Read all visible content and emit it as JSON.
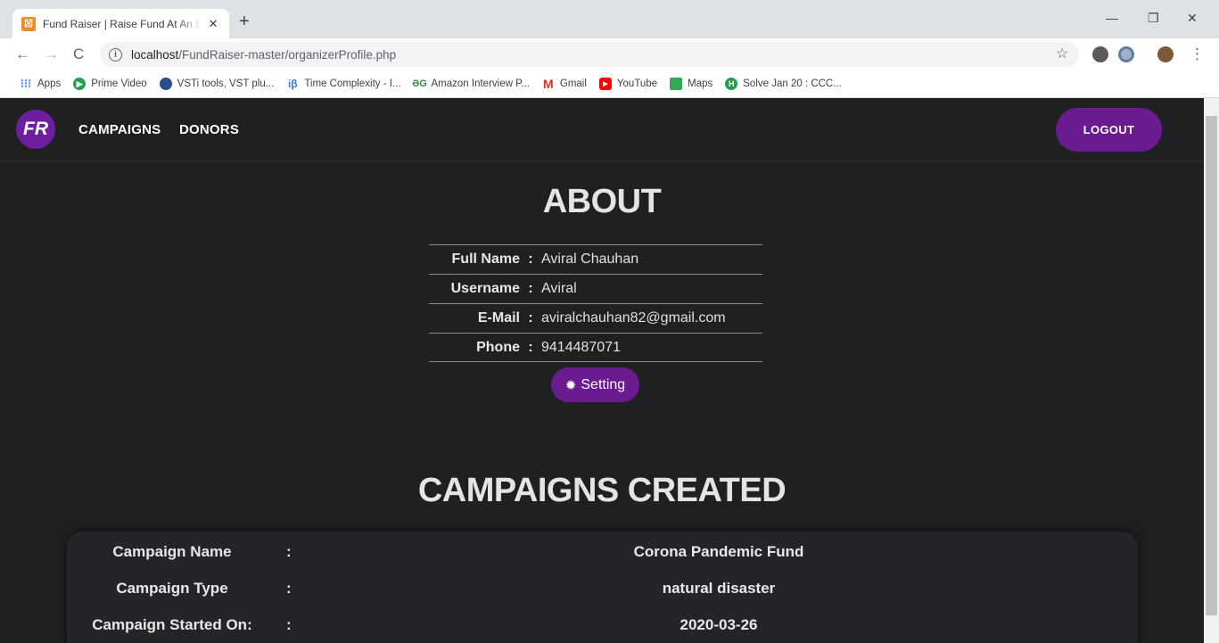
{
  "browser": {
    "tab_title": "Fund Raiser | Raise Fund At An Ea",
    "tab_favicon": "fr-favicon",
    "url_host": "localhost",
    "url_path": "/FundRaiser-master/organizerProfile.php",
    "bookmarks": [
      {
        "label": "Apps",
        "icon": "apps-grid-icon"
      },
      {
        "label": "Prime Video",
        "icon": "prime-video-icon"
      },
      {
        "label": "VSTi tools, VST plu...",
        "icon": "vst-icon"
      },
      {
        "label": "Time Complexity - I...",
        "icon": "ib-icon"
      },
      {
        "label": "Amazon Interview P...",
        "icon": "gfg-icon"
      },
      {
        "label": "Gmail",
        "icon": "gmail-icon"
      },
      {
        "label": "YouTube",
        "icon": "youtube-icon"
      },
      {
        "label": "Maps",
        "icon": "maps-icon"
      },
      {
        "label": "Solve Jan 20 : CCC...",
        "icon": "codechef-icon"
      }
    ]
  },
  "navbar": {
    "logo_text": "FR",
    "links": [
      "CAMPAIGNS",
      "DONORS"
    ],
    "logout_label": "LOGOUT"
  },
  "about": {
    "title": "ABOUT",
    "rows": [
      {
        "label": "Full Name",
        "value": "Aviral Chauhan"
      },
      {
        "label": "Username",
        "value": "Aviral"
      },
      {
        "label": "E-Mail",
        "value": "aviralchauhan82@gmail.com"
      },
      {
        "label": "Phone",
        "value": "9414487071"
      }
    ],
    "setting_label": "Setting"
  },
  "campaigns": {
    "title": "CAMPAIGNS CREATED",
    "rows": [
      {
        "label": "Campaign Name",
        "value": "Corona Pandemic Fund"
      },
      {
        "label": "Campaign Type",
        "value": "natural disaster"
      },
      {
        "label": "Campaign Started On:",
        "value": "2020-03-26"
      }
    ]
  },
  "colors": {
    "accent": "#6a1b8f",
    "background": "#1f2022"
  }
}
